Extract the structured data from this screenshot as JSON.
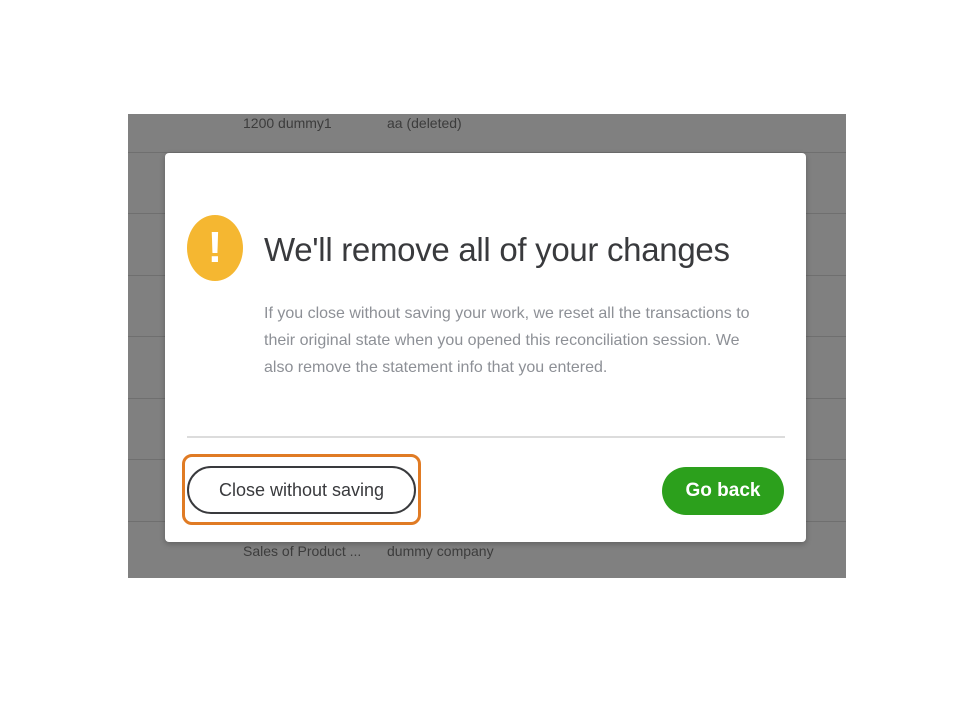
{
  "background": {
    "rows": [
      {
        "col1": "1200 dummy1",
        "col2": "aa (deleted)"
      },
      {
        "col1": "Sales of Product ...",
        "col2": "dummy company"
      }
    ]
  },
  "dialog": {
    "icon": "warning-icon",
    "icon_glyph": "!",
    "title": "We'll remove all of your changes",
    "body": "If you close without saving your work, we reset all the transactions to their original state when you opened this reconciliation session. We also remove the statement info that you entered.",
    "close_button": "Close without saving",
    "back_button": "Go back"
  },
  "colors": {
    "overlay": "#808080",
    "warning": "#f5b731",
    "primary": "#2ca01c",
    "highlight": "#e07b24"
  }
}
